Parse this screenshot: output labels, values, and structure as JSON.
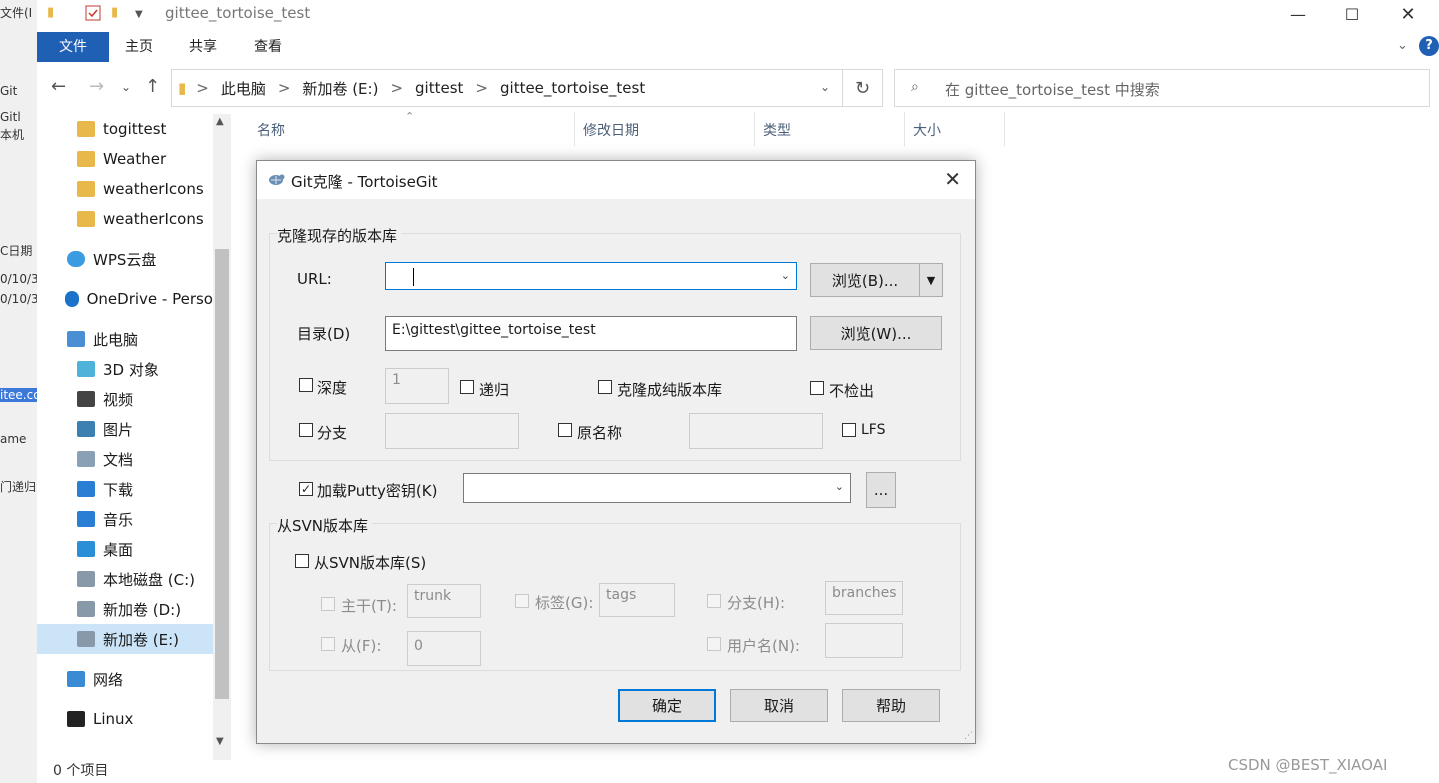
{
  "bg_window": {
    "fragments": [
      "文件(I",
      "Git",
      "Gitl",
      "本机",
      "C日期",
      "0/10/3",
      "0/10/3",
      "itee.co",
      "ame",
      "门递归"
    ]
  },
  "explorer": {
    "title": "gittee_tortoise_test",
    "ribbon_tabs": [
      "文件",
      "主页",
      "共享",
      "查看"
    ],
    "help_label": "?",
    "address": {
      "segments": [
        "此电脑",
        "新加卷 (E:)",
        "gittest",
        "gittee_tortoise_test"
      ],
      "separator": ">"
    },
    "search_placeholder": "在 gittee_tortoise_test 中搜索",
    "columns": [
      "名称",
      "修改日期",
      "类型",
      "大小"
    ],
    "sidebar_items": [
      {
        "label": "togittest",
        "icon": "folder-synced-icon"
      },
      {
        "label": "Weather",
        "icon": "folder-icon"
      },
      {
        "label": "weatherIcons",
        "icon": "folder-icon"
      },
      {
        "label": "weatherIcons",
        "icon": "folder-icon"
      },
      {
        "label": "WPS云盘",
        "icon": "cloud-icon"
      },
      {
        "label": "OneDrive - Perso",
        "icon": "onedrive-icon"
      },
      {
        "label": "此电脑",
        "icon": "pc-icon"
      },
      {
        "label": "3D 对象",
        "icon": "3d-objects-icon"
      },
      {
        "label": "视频",
        "icon": "video-icon"
      },
      {
        "label": "图片",
        "icon": "pictures-icon"
      },
      {
        "label": "文档",
        "icon": "documents-icon"
      },
      {
        "label": "下载",
        "icon": "download-icon"
      },
      {
        "label": "音乐",
        "icon": "music-icon"
      },
      {
        "label": "桌面",
        "icon": "desktop-icon"
      },
      {
        "label": "本地磁盘 (C:)",
        "icon": "drive-c-icon"
      },
      {
        "label": "新加卷 (D:)",
        "icon": "drive-icon"
      },
      {
        "label": "新加卷 (E:)",
        "icon": "drive-icon",
        "selected": true
      },
      {
        "label": "网络",
        "icon": "network-icon"
      },
      {
        "label": "Linux",
        "icon": "linux-icon"
      }
    ],
    "status": "0 个项目"
  },
  "dialog": {
    "title": "Git克隆 - TortoiseGit",
    "clone_group": "克隆现存的版本库",
    "url_label": "URL:",
    "url_value": "",
    "browse_url_label": "浏览(B)...",
    "dir_label": "目录(D)",
    "dir_value": "E:\\gittest\\gittee_tortoise_test",
    "browse_dir_label": "浏览(W)...",
    "depth_label": "深度",
    "depth_value": "1",
    "recursive_label": "递归",
    "bare_label": "克隆成纯版本库",
    "no_checkout_label": "不检出",
    "branch_label": "分支",
    "origin_label": "原名称",
    "lfs_label": "LFS",
    "putty_label": "加载Putty密钥(K)",
    "putty_checked": true,
    "putty_value": "",
    "putty_browse_label": "...",
    "svn_group": "从SVN版本库",
    "svn_checkbox_label": "从SVN版本库(S)",
    "trunk_label": "主干(T):",
    "trunk_value": "trunk",
    "tags_label": "标签(G):",
    "tags_value": "tags",
    "branches_label": "分支(H):",
    "branches_value": "branches",
    "from_label": "从(F):",
    "from_value": "0",
    "username_label": "用户名(N):",
    "username_value": "",
    "ok_label": "确定",
    "cancel_label": "取消",
    "help_label": "帮助"
  },
  "watermark": "CSDN @BEST_XIAOAI",
  "colors": {
    "accent": "#1f5fb4",
    "selection": "#cce4f7",
    "dialog_bg": "#f0f0f0",
    "focus_border": "#0078d7"
  }
}
